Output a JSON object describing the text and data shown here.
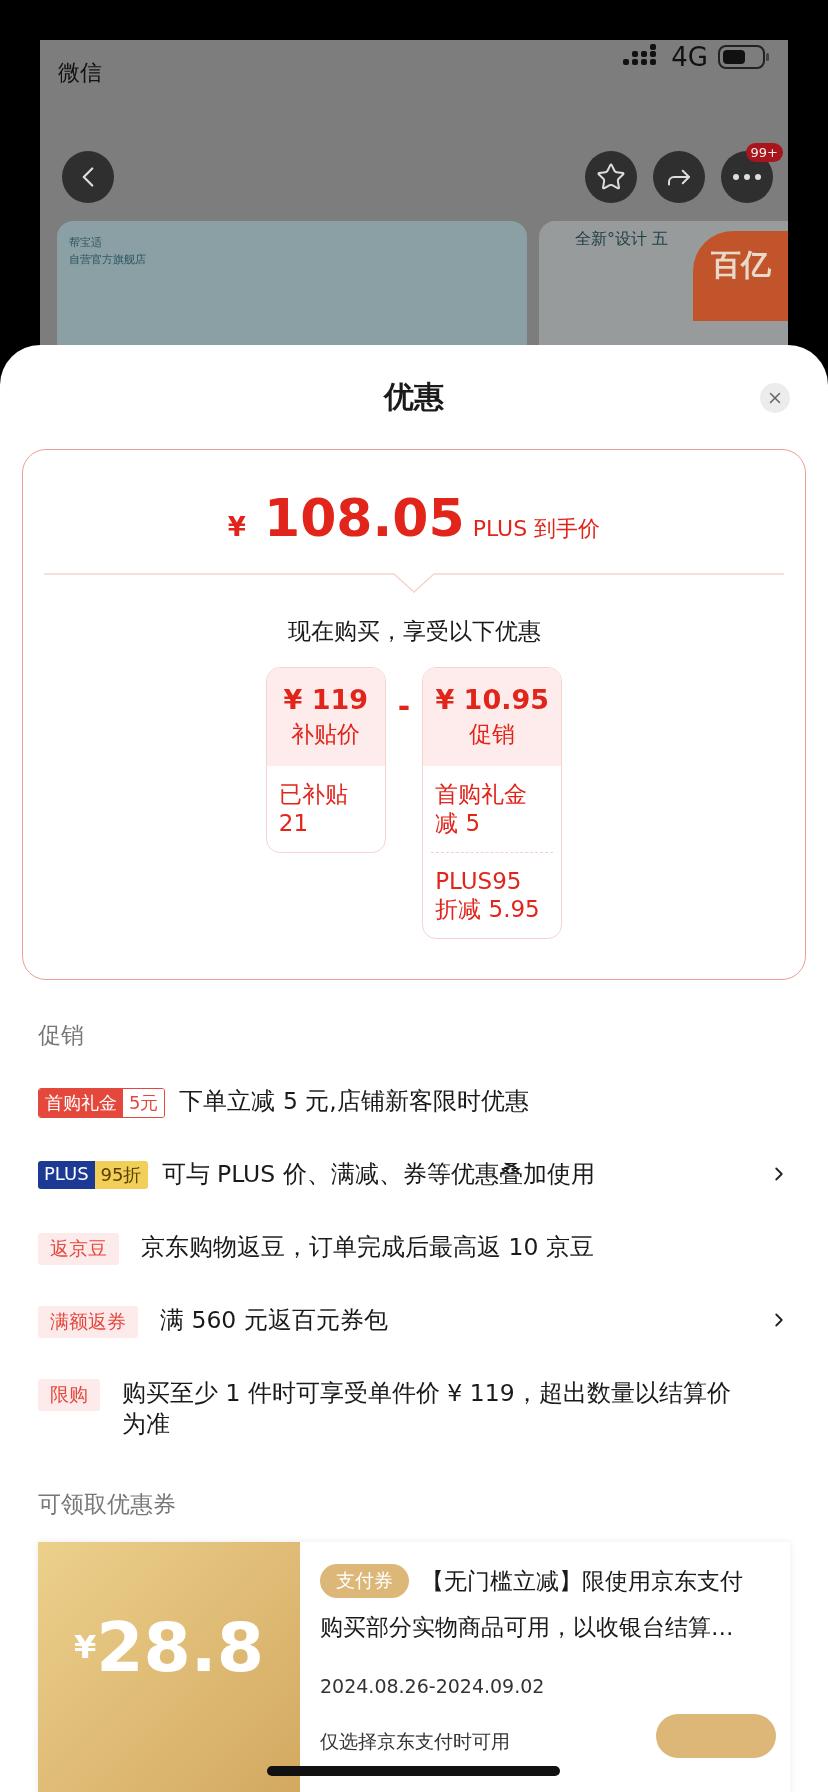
{
  "status_bar": {
    "back_app": "微信",
    "network": "4G"
  },
  "product_page": {
    "store_brand": "帮宝适",
    "store_name": "自营官方旗舰店",
    "banner_text": "全新°设计 五",
    "subsidy_badge": "百亿",
    "more_badge": "99+"
  },
  "sheet": {
    "title": "优惠"
  },
  "price_card": {
    "currency": "¥",
    "price": "108.05",
    "price_label": "PLUS 到手价",
    "intro": "现在购买，享受以下优惠",
    "operator": "-",
    "parts": [
      {
        "currency": "¥",
        "amount": "119",
        "label": "补贴价",
        "details": [
          "已补贴 21"
        ]
      },
      {
        "currency": "¥",
        "amount": "10.95",
        "label": "促销",
        "details": [
          "首购礼金减 5",
          "PLUS95 折减 5.95"
        ]
      }
    ]
  },
  "promotions": {
    "title": "促销",
    "items": [
      {
        "kind": "split",
        "tag": "首购礼金",
        "tag_value": "5元",
        "text": "下单立减 5 元,店铺新客限时优惠",
        "has_arrow": false
      },
      {
        "kind": "plus",
        "tag": "PLUS",
        "tag_value": "95折",
        "text": "可与 PLUS 价、满减、券等优惠叠加使用",
        "has_arrow": true
      },
      {
        "kind": "plain",
        "tag": "返京豆",
        "text": "京东购物返豆，订单完成后最高返 10 京豆",
        "has_arrow": false
      },
      {
        "kind": "plain",
        "tag": "满额返券",
        "text": "满 560 元返百元券包",
        "has_arrow": true
      },
      {
        "kind": "plain",
        "tag": "限购",
        "text": "购买至少 1 件时可享受单件价 ¥ 119，超出数量以结算价为准",
        "has_arrow": false
      }
    ]
  },
  "coupons": {
    "title": "可领取优惠券",
    "items": [
      {
        "currency": "¥",
        "amount": "28.8",
        "type_tag": "支付券",
        "title": "【无门槛立减】限使用京东支付",
        "description": "购买部分实物商品可用，以收银台结算…",
        "validity": "2024.08.26-2024.09.02",
        "note": "仅选择京东支付时可用"
      }
    ]
  }
}
